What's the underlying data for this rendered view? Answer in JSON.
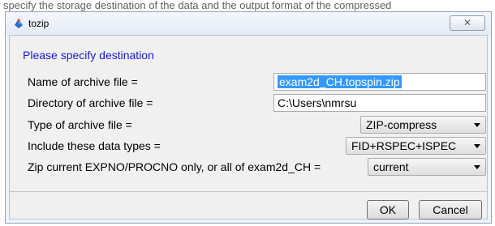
{
  "background": {
    "text": "specify the storage destination of the data and the output format of the compressed"
  },
  "window": {
    "title": "tozip",
    "close_glyph": "✕",
    "icon": "topspin-app-icon"
  },
  "header": "Please specify destination",
  "fields": {
    "archive_name": {
      "label": "Name of archive file =",
      "value": "exam2d_CH.topspin.zip"
    },
    "directory": {
      "label": "Directory of archive file =",
      "value": "C:\\Users\\nmrsu"
    },
    "archive_type": {
      "label": "Type of archive file =",
      "value": "ZIP-compress"
    },
    "data_types": {
      "label": "Include these data types =",
      "value": "FID+RSPEC+ISPEC"
    },
    "scope": {
      "label": "Zip current EXPNO/PROCNO only, or all of exam2d_CH =",
      "value": "current"
    }
  },
  "buttons": {
    "ok": "OK",
    "cancel": "Cancel"
  },
  "colors": {
    "header": "#1a1adc",
    "selection": "#3399ff"
  }
}
